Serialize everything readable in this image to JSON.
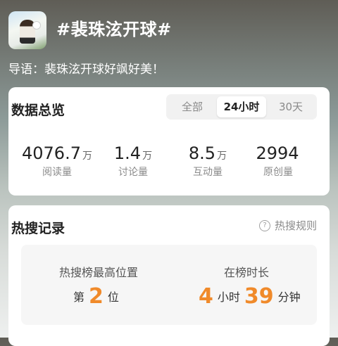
{
  "header": {
    "title": "#裴珠泫开球#",
    "intro": "导语：裴珠泫开球好飒好美！"
  },
  "data_overview": {
    "title": "数据总览",
    "tabs": [
      {
        "label": "全部",
        "selected": false
      },
      {
        "label": "24小时",
        "selected": true
      },
      {
        "label": "30天",
        "selected": false
      }
    ],
    "stats": [
      {
        "value": "4076.7",
        "unit": "万",
        "label": "阅读量"
      },
      {
        "value": "1.4",
        "unit": "万",
        "label": "讨论量"
      },
      {
        "value": "8.5",
        "unit": "万",
        "label": "互动量"
      },
      {
        "value": "2994",
        "unit": "",
        "label": "原创量"
      }
    ]
  },
  "hot_search": {
    "title": "热搜记录",
    "rules_label": "热搜规则",
    "highest_label": "热搜榜最高位置",
    "highest_prefix": "第",
    "highest_value": "2",
    "highest_suffix": "位",
    "duration_label": "在榜时长",
    "duration_hours": "4",
    "hours_unit": "小时",
    "duration_minutes": "39",
    "minutes_unit": "分钟"
  },
  "colors": {
    "accent": "#f08a2a",
    "card": "#ffffff",
    "text": "#222222",
    "muted": "#8a8a8a"
  }
}
